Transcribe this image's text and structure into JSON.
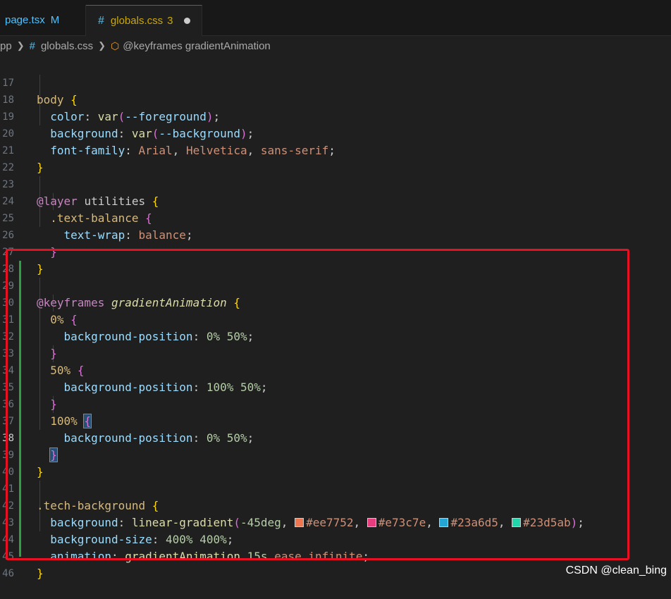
{
  "tabs": [
    {
      "name": "page.tsx",
      "badge": "M"
    },
    {
      "name": "globals.css",
      "badge": "3",
      "icon": "#"
    }
  ],
  "breadcrumb": {
    "folder": "pp",
    "file": "globals.css",
    "file_icon": "#",
    "symbol": "@keyframes gradientAnimation"
  },
  "lines": [
    {
      "n": "17"
    },
    {
      "n": "18"
    },
    {
      "n": "19"
    },
    {
      "n": "20"
    },
    {
      "n": "21"
    },
    {
      "n": "22"
    },
    {
      "n": "23"
    },
    {
      "n": "24"
    },
    {
      "n": "25"
    },
    {
      "n": "26"
    },
    {
      "n": "27"
    },
    {
      "n": "28"
    },
    {
      "n": "29"
    },
    {
      "n": "30"
    },
    {
      "n": "31"
    },
    {
      "n": "32"
    },
    {
      "n": "33"
    },
    {
      "n": "34"
    },
    {
      "n": "35"
    },
    {
      "n": "36"
    },
    {
      "n": "37"
    },
    {
      "n": "38"
    },
    {
      "n": "39"
    },
    {
      "n": "40"
    },
    {
      "n": "41"
    },
    {
      "n": "42"
    },
    {
      "n": "43"
    },
    {
      "n": "44"
    },
    {
      "n": "45"
    },
    {
      "n": "46"
    }
  ],
  "code": {
    "body_sel": "body",
    "color_prop": "color",
    "var_fn": "var",
    "fg_var": "--foreground",
    "bg_prop": "background",
    "bg_var": "--background",
    "ff_prop": "font-family",
    "ff_arial": "Arial",
    "ff_helv": "Helvetica",
    "ff_sans": "sans-serif",
    "layer_kw": "@layer",
    "layer_name": "utilities",
    "tb_sel": ".text-balance",
    "tw_prop": "text-wrap",
    "tw_val": "balance",
    "kf_kw": "@keyframes",
    "kf_name": "gradientAnimation",
    "pct0": "0%",
    "pct50": "50%",
    "pct100": "100%",
    "bp_prop": "background-position",
    "bp0": "0% 50%",
    "bp100": "100% 50%",
    "tech_sel": ".tech-background",
    "lg_fn": "linear-gradient",
    "angle": "-45deg",
    "c1": "#ee7752",
    "c2": "#e73c7e",
    "c3": "#23a6d5",
    "c4": "#23d5ab",
    "bs_prop": "background-size",
    "bs_val": "400% 400%",
    "anim_prop": "animation",
    "anim_name": "gradientAnimation",
    "anim_dur": "15s",
    "anim_ease": "ease",
    "anim_inf": "infinite"
  },
  "watermark": "CSDN @clean_bing",
  "colors": {
    "accent": "#0078d4",
    "highlight": "#e81123",
    "swatch1": "#ee7752",
    "swatch2": "#e73c7e",
    "swatch3": "#23a6d5",
    "swatch4": "#23d5ab"
  }
}
